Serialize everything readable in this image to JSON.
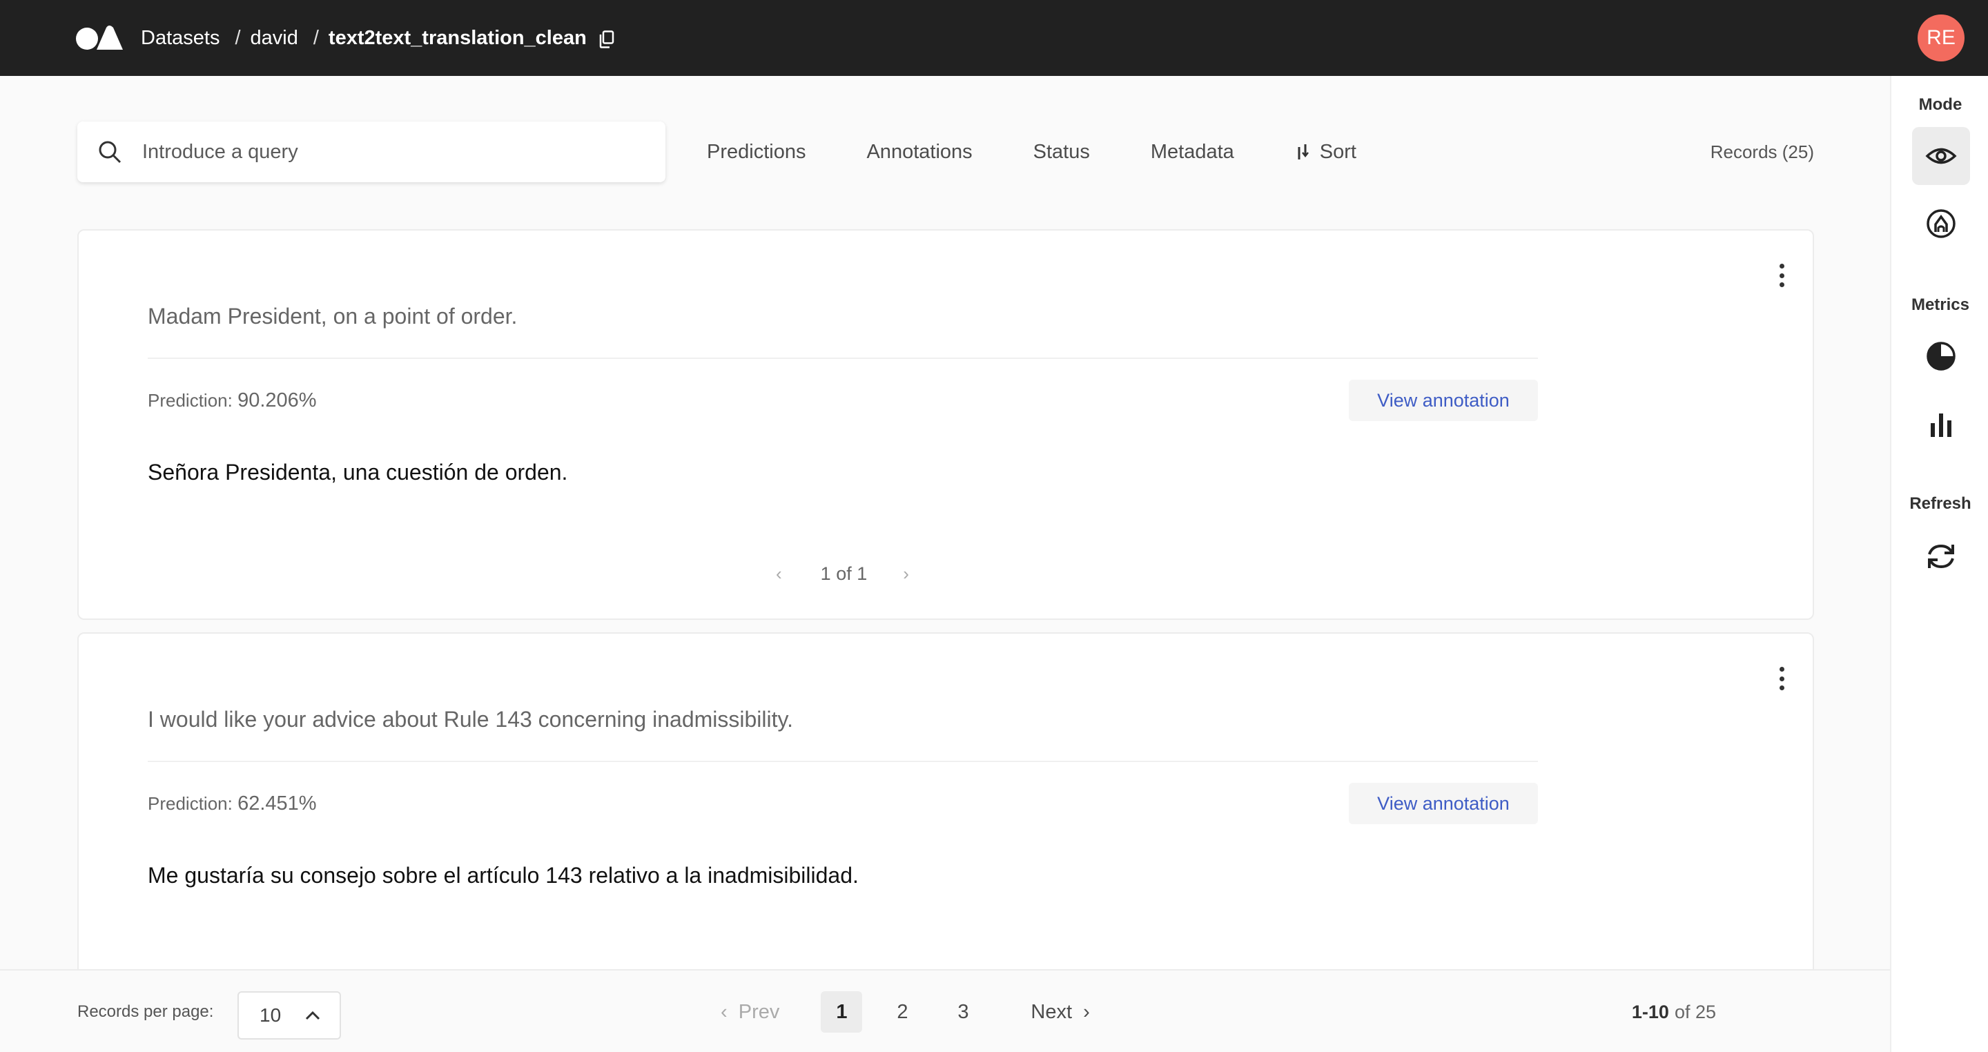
{
  "header": {
    "breadcrumbs": [
      "Datasets",
      "david",
      "text2text_translation_clean"
    ],
    "avatar_initials": "RE",
    "avatar_color": "#f36b5e"
  },
  "search": {
    "placeholder": "Introduce a query"
  },
  "filters": {
    "predictions": "Predictions",
    "annotations": "Annotations",
    "status": "Status",
    "metadata": "Metadata",
    "sort": "Sort"
  },
  "records_count": "Records (25)",
  "sidebar": {
    "mode_label": "Mode",
    "metrics_label": "Metrics",
    "refresh_label": "Refresh",
    "icons": [
      "eye-icon",
      "edit-annotate-icon",
      "pie-chart-icon",
      "bar-chart-icon",
      "refresh-icon"
    ]
  },
  "records": [
    {
      "text": "Madam President, on a point of order.",
      "prediction_label": "Prediction:",
      "prediction_value": "90.206%",
      "view_label": "View annotation",
      "translation": "Señora Presidenta, una cuestión de orden.",
      "pager": "1 of 1"
    },
    {
      "text": "I would like your advice about Rule 143 concerning inadmissibility.",
      "prediction_label": "Prediction:",
      "prediction_value": "62.451%",
      "view_label": "View annotation",
      "translation": "Me gustaría su consejo sobre el artículo 143 relativo a la inadmisibilidad."
    }
  ],
  "footer": {
    "rpp_label": "Records per page:",
    "rpp_value": "10",
    "prev": "Prev",
    "pages": [
      "1",
      "2",
      "3"
    ],
    "next": "Next",
    "range_bold": "1-10",
    "range_rest": "of 25"
  },
  "accent_color": "#3e5cc5"
}
